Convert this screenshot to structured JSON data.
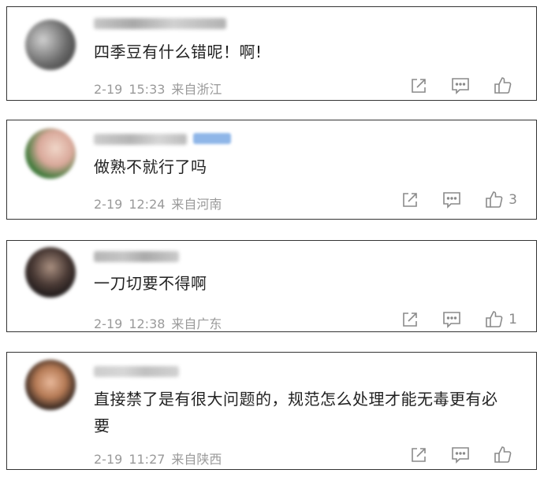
{
  "comments": [
    {
      "text": "四季豆有什么错呢！啊!",
      "date": "2-19",
      "time": "15:33",
      "location": "来自浙江",
      "likes": ""
    },
    {
      "text": "做熟不就行了吗",
      "date": "2-19",
      "time": "12:24",
      "location": "来自河南",
      "likes": "3"
    },
    {
      "text": "一刀切要不得啊",
      "date": "2-19",
      "time": "12:38",
      "location": "来自广东",
      "likes": "1"
    },
    {
      "text": "直接禁了是有很大问题的，规范怎么处理才能无毒更有必要",
      "date": "2-19",
      "time": "11:27",
      "location": "来自陕西",
      "likes": ""
    }
  ],
  "icons": {
    "share": "share-icon",
    "reply": "reply-icon",
    "like": "thumbs-up-icon"
  },
  "colors": {
    "meta_text": "#9a9a9a",
    "comment_text": "#222222",
    "badge": "#8fb6e8"
  }
}
